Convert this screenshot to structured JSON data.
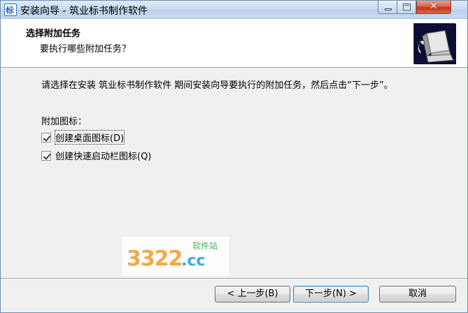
{
  "window": {
    "title": "安装向导 - 筑业标书制作软件",
    "app_icon_glyph": "标",
    "close_glyph": "✕"
  },
  "header": {
    "title": "选择附加任务",
    "subtitle": "要执行哪些附加任务？"
  },
  "content": {
    "description": "请选择在安装 筑业标书制作软件 期间安装向导要执行的附加任务，然后点击“下一步”。",
    "group_label": "附加图标：",
    "tasks": [
      {
        "label": "创建桌面图标(D)",
        "checked": true
      },
      {
        "label": "创建快速启动栏图标(Q)",
        "checked": true
      }
    ]
  },
  "watermark": {
    "main": "3322",
    "suffix": ".cc",
    "tag": "软件站"
  },
  "buttons": {
    "back": "< 上一步(B)",
    "next": "下一步(N) >",
    "cancel": "取消"
  },
  "colors": {
    "titlebar": "#c9dbef",
    "close_button": "#c5321b",
    "default_button_border": "#3c7fb1"
  }
}
